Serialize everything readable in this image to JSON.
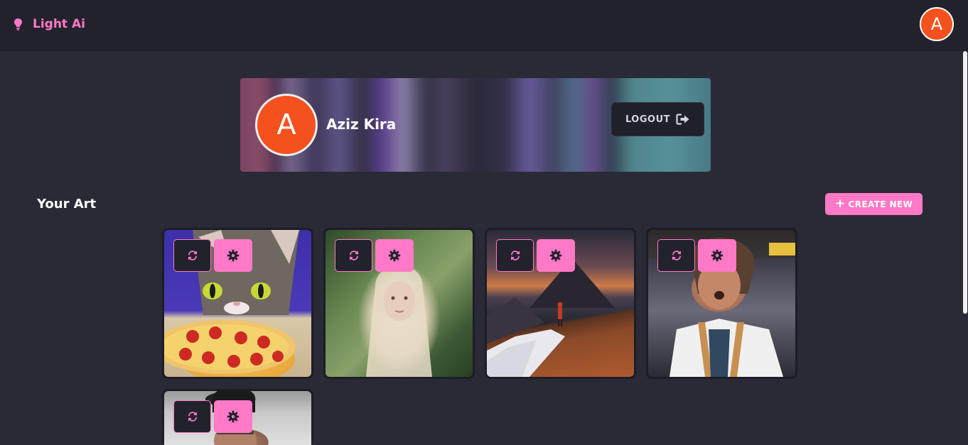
{
  "header": {
    "brand_name": "Light Ai",
    "brand_icon": "lightbulb-icon",
    "avatar_initial": "A"
  },
  "profile": {
    "avatar_initial": "A",
    "name": "Aziz Kira",
    "logout_label": "LOGOUT",
    "logout_icon": "logout-icon"
  },
  "section": {
    "title": "Your Art",
    "create_label": "CREATE NEW",
    "create_icon": "plus-icon"
  },
  "art_cards": [
    {
      "id": "cat-pizza",
      "regenerate_icon": "refresh-icon",
      "settings_icon": "gear-icon"
    },
    {
      "id": "girl-forest",
      "regenerate_icon": "refresh-icon",
      "settings_icon": "gear-icon"
    },
    {
      "id": "mountain-hiker",
      "regenerate_icon": "refresh-icon",
      "settings_icon": "gear-icon"
    },
    {
      "id": "man-street",
      "regenerate_icon": "refresh-icon",
      "settings_icon": "gear-icon"
    },
    {
      "id": "old-man-portrait",
      "regenerate_icon": "refresh-icon",
      "settings_icon": "gear-icon"
    }
  ],
  "colors": {
    "accent": "#ff79c6",
    "background": "#2a2a37",
    "topbar": "#22222d",
    "avatar": "#f4511e"
  }
}
